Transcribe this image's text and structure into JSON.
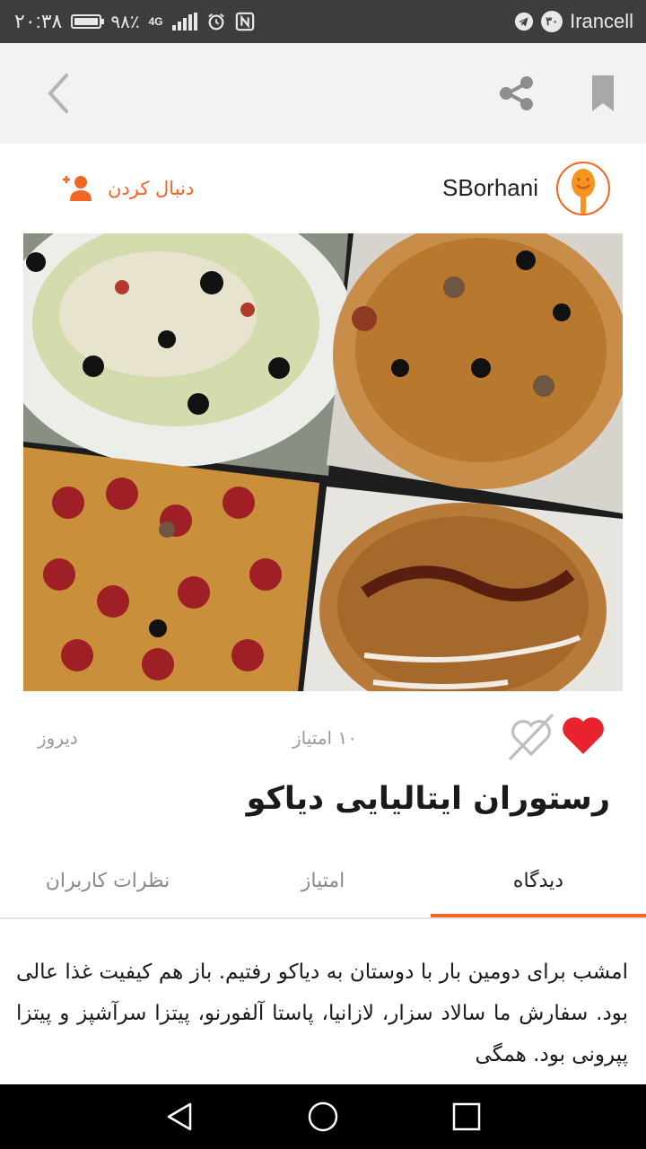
{
  "status_bar": {
    "time": "۲۰:۳۸",
    "battery": "۹۸٪",
    "battery_level": 0.98,
    "network_type": "4G",
    "carrier": "Irancell",
    "carrier_badge": "۳۰",
    "icons": [
      "battery-icon",
      "signal-icon",
      "alarm-icon",
      "nfc-icon",
      "telegram-icon"
    ]
  },
  "top_bar": {
    "icons": [
      "back-icon",
      "share-icon",
      "bookmark-icon"
    ]
  },
  "author": {
    "username": "SBorhani",
    "follow_label": "دنبال کردن",
    "avatar_icon": "spoon-smile-icon",
    "follow_icon": "add-user-icon"
  },
  "post": {
    "photo_description_icon": "food-collage-photo",
    "date": "دیروز",
    "points": "۱۰ امتیاز",
    "title": "رستوران ایتالیایی دیاکو",
    "like_icon": "heart-icon",
    "dislike_icon": "broken-heart-icon"
  },
  "tabs": [
    {
      "label": "دیدگاه",
      "active": true
    },
    {
      "label": "امتیاز",
      "active": false
    },
    {
      "label": "نظرات کاربران",
      "active": false
    }
  ],
  "review_text": "امشب برای دومین بار با دوستان به دیاکو رفتیم. باز هم کیفیت غذا عالی بود. سفارش ما سالاد سزار، لازانیا، پاستا آلفورنو، پیتزا سرآشپز و پیتزا پپرونی بود. همگی",
  "colors": {
    "accent": "#f26522",
    "like": "#e8232e",
    "status_bar": "#3d3d3d",
    "top_bar": "#f2f2f2"
  },
  "nav_bar": {
    "icons": [
      "nav-back-icon",
      "nav-home-icon",
      "nav-recents-icon"
    ]
  }
}
